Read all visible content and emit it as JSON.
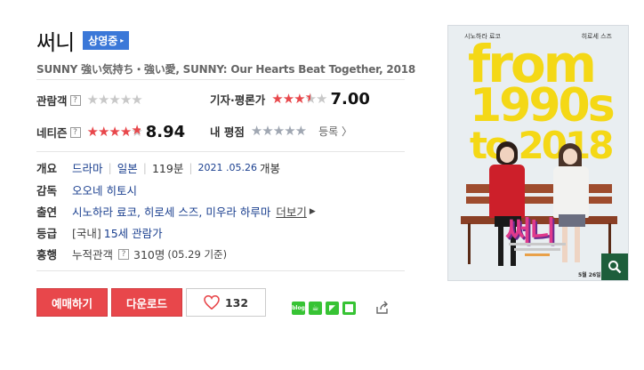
{
  "movie": {
    "title": "써니",
    "status_badge": "상영중",
    "subtitle": "SUNNY 強い気持ち・強い愛, SUNNY: Our Hearts Beat Together, 2018"
  },
  "ratings": {
    "audience_label": "관람객",
    "audience_stars": "★★★★★",
    "critic_label": "기자·평론가",
    "critic_stars": "★★★★★",
    "critic_score": "7.00",
    "netizen_label": "네티즌",
    "netizen_stars": "★★★★★",
    "netizen_score": "8.94",
    "my_label": "내 평점",
    "my_stars": "★★★★★",
    "register_label": "등록",
    "help_icon_text": "?"
  },
  "info": {
    "overview_label": "개요",
    "genre": "드라마",
    "country": "일본",
    "runtime": "119분",
    "release_date": "2021 .05.26",
    "release_suffix": "개봉",
    "director_label": "감독",
    "director": "오오네 히토시",
    "cast_label": "출연",
    "cast": "시노하라 료코, 히로세 스즈, 미우라 하루마",
    "more_label": "더보기",
    "grade_label": "등급",
    "grade_prefix": "[국내]",
    "grade": "15세 관람가",
    "boxoffice_label": "흥행",
    "boxoffice_sub": "누적관객",
    "boxoffice_value": "310명",
    "boxoffice_date": "(05.29 기준)"
  },
  "actions": {
    "reserve": "예매하기",
    "download": "다운로드",
    "like_count": "132"
  },
  "poster": {
    "top_left": "시노하라 료코",
    "top_right": "히로세 스즈",
    "line1": "from",
    "line2": "1990s",
    "line3": "to 2018",
    "title": "써니",
    "bottom_text": "5월 26일"
  },
  "colors": {
    "accent_red": "#e8474b",
    "badge_blue": "#3b78d8",
    "star_red": "#e8474b",
    "star_gray": "#c8c8c8",
    "link_blue": "#1a3f8f",
    "share_green": "#37c334",
    "poster_yellow": "#f4d816"
  }
}
